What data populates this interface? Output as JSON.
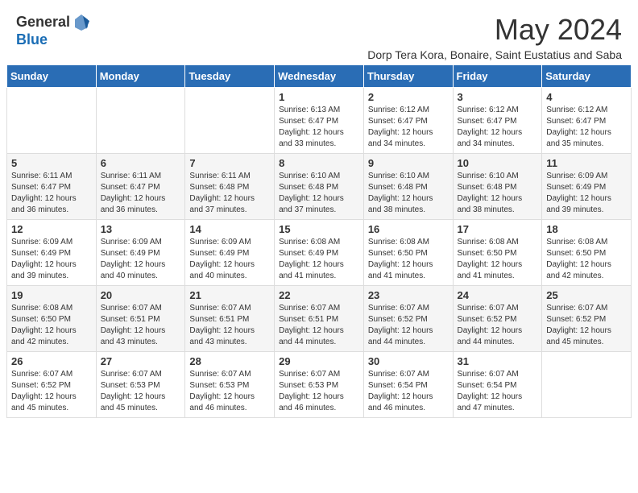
{
  "header": {
    "logo_general": "General",
    "logo_blue": "Blue",
    "month_year": "May 2024",
    "location": "Dorp Tera Kora, Bonaire, Saint Eustatius and Saba"
  },
  "weekdays": [
    "Sunday",
    "Monday",
    "Tuesday",
    "Wednesday",
    "Thursday",
    "Friday",
    "Saturday"
  ],
  "weeks": [
    [
      {
        "day": "",
        "info": ""
      },
      {
        "day": "",
        "info": ""
      },
      {
        "day": "",
        "info": ""
      },
      {
        "day": "1",
        "info": "Sunrise: 6:13 AM\nSunset: 6:47 PM\nDaylight: 12 hours\nand 33 minutes."
      },
      {
        "day": "2",
        "info": "Sunrise: 6:12 AM\nSunset: 6:47 PM\nDaylight: 12 hours\nand 34 minutes."
      },
      {
        "day": "3",
        "info": "Sunrise: 6:12 AM\nSunset: 6:47 PM\nDaylight: 12 hours\nand 34 minutes."
      },
      {
        "day": "4",
        "info": "Sunrise: 6:12 AM\nSunset: 6:47 PM\nDaylight: 12 hours\nand 35 minutes."
      }
    ],
    [
      {
        "day": "5",
        "info": "Sunrise: 6:11 AM\nSunset: 6:47 PM\nDaylight: 12 hours\nand 36 minutes."
      },
      {
        "day": "6",
        "info": "Sunrise: 6:11 AM\nSunset: 6:47 PM\nDaylight: 12 hours\nand 36 minutes."
      },
      {
        "day": "7",
        "info": "Sunrise: 6:11 AM\nSunset: 6:48 PM\nDaylight: 12 hours\nand 37 minutes."
      },
      {
        "day": "8",
        "info": "Sunrise: 6:10 AM\nSunset: 6:48 PM\nDaylight: 12 hours\nand 37 minutes."
      },
      {
        "day": "9",
        "info": "Sunrise: 6:10 AM\nSunset: 6:48 PM\nDaylight: 12 hours\nand 38 minutes."
      },
      {
        "day": "10",
        "info": "Sunrise: 6:10 AM\nSunset: 6:48 PM\nDaylight: 12 hours\nand 38 minutes."
      },
      {
        "day": "11",
        "info": "Sunrise: 6:09 AM\nSunset: 6:49 PM\nDaylight: 12 hours\nand 39 minutes."
      }
    ],
    [
      {
        "day": "12",
        "info": "Sunrise: 6:09 AM\nSunset: 6:49 PM\nDaylight: 12 hours\nand 39 minutes."
      },
      {
        "day": "13",
        "info": "Sunrise: 6:09 AM\nSunset: 6:49 PM\nDaylight: 12 hours\nand 40 minutes."
      },
      {
        "day": "14",
        "info": "Sunrise: 6:09 AM\nSunset: 6:49 PM\nDaylight: 12 hours\nand 40 minutes."
      },
      {
        "day": "15",
        "info": "Sunrise: 6:08 AM\nSunset: 6:49 PM\nDaylight: 12 hours\nand 41 minutes."
      },
      {
        "day": "16",
        "info": "Sunrise: 6:08 AM\nSunset: 6:50 PM\nDaylight: 12 hours\nand 41 minutes."
      },
      {
        "day": "17",
        "info": "Sunrise: 6:08 AM\nSunset: 6:50 PM\nDaylight: 12 hours\nand 41 minutes."
      },
      {
        "day": "18",
        "info": "Sunrise: 6:08 AM\nSunset: 6:50 PM\nDaylight: 12 hours\nand 42 minutes."
      }
    ],
    [
      {
        "day": "19",
        "info": "Sunrise: 6:08 AM\nSunset: 6:50 PM\nDaylight: 12 hours\nand 42 minutes."
      },
      {
        "day": "20",
        "info": "Sunrise: 6:07 AM\nSunset: 6:51 PM\nDaylight: 12 hours\nand 43 minutes."
      },
      {
        "day": "21",
        "info": "Sunrise: 6:07 AM\nSunset: 6:51 PM\nDaylight: 12 hours\nand 43 minutes."
      },
      {
        "day": "22",
        "info": "Sunrise: 6:07 AM\nSunset: 6:51 PM\nDaylight: 12 hours\nand 44 minutes."
      },
      {
        "day": "23",
        "info": "Sunrise: 6:07 AM\nSunset: 6:52 PM\nDaylight: 12 hours\nand 44 minutes."
      },
      {
        "day": "24",
        "info": "Sunrise: 6:07 AM\nSunset: 6:52 PM\nDaylight: 12 hours\nand 44 minutes."
      },
      {
        "day": "25",
        "info": "Sunrise: 6:07 AM\nSunset: 6:52 PM\nDaylight: 12 hours\nand 45 minutes."
      }
    ],
    [
      {
        "day": "26",
        "info": "Sunrise: 6:07 AM\nSunset: 6:52 PM\nDaylight: 12 hours\nand 45 minutes."
      },
      {
        "day": "27",
        "info": "Sunrise: 6:07 AM\nSunset: 6:53 PM\nDaylight: 12 hours\nand 45 minutes."
      },
      {
        "day": "28",
        "info": "Sunrise: 6:07 AM\nSunset: 6:53 PM\nDaylight: 12 hours\nand 46 minutes."
      },
      {
        "day": "29",
        "info": "Sunrise: 6:07 AM\nSunset: 6:53 PM\nDaylight: 12 hours\nand 46 minutes."
      },
      {
        "day": "30",
        "info": "Sunrise: 6:07 AM\nSunset: 6:54 PM\nDaylight: 12 hours\nand 46 minutes."
      },
      {
        "day": "31",
        "info": "Sunrise: 6:07 AM\nSunset: 6:54 PM\nDaylight: 12 hours\nand 47 minutes."
      },
      {
        "day": "",
        "info": ""
      }
    ]
  ]
}
